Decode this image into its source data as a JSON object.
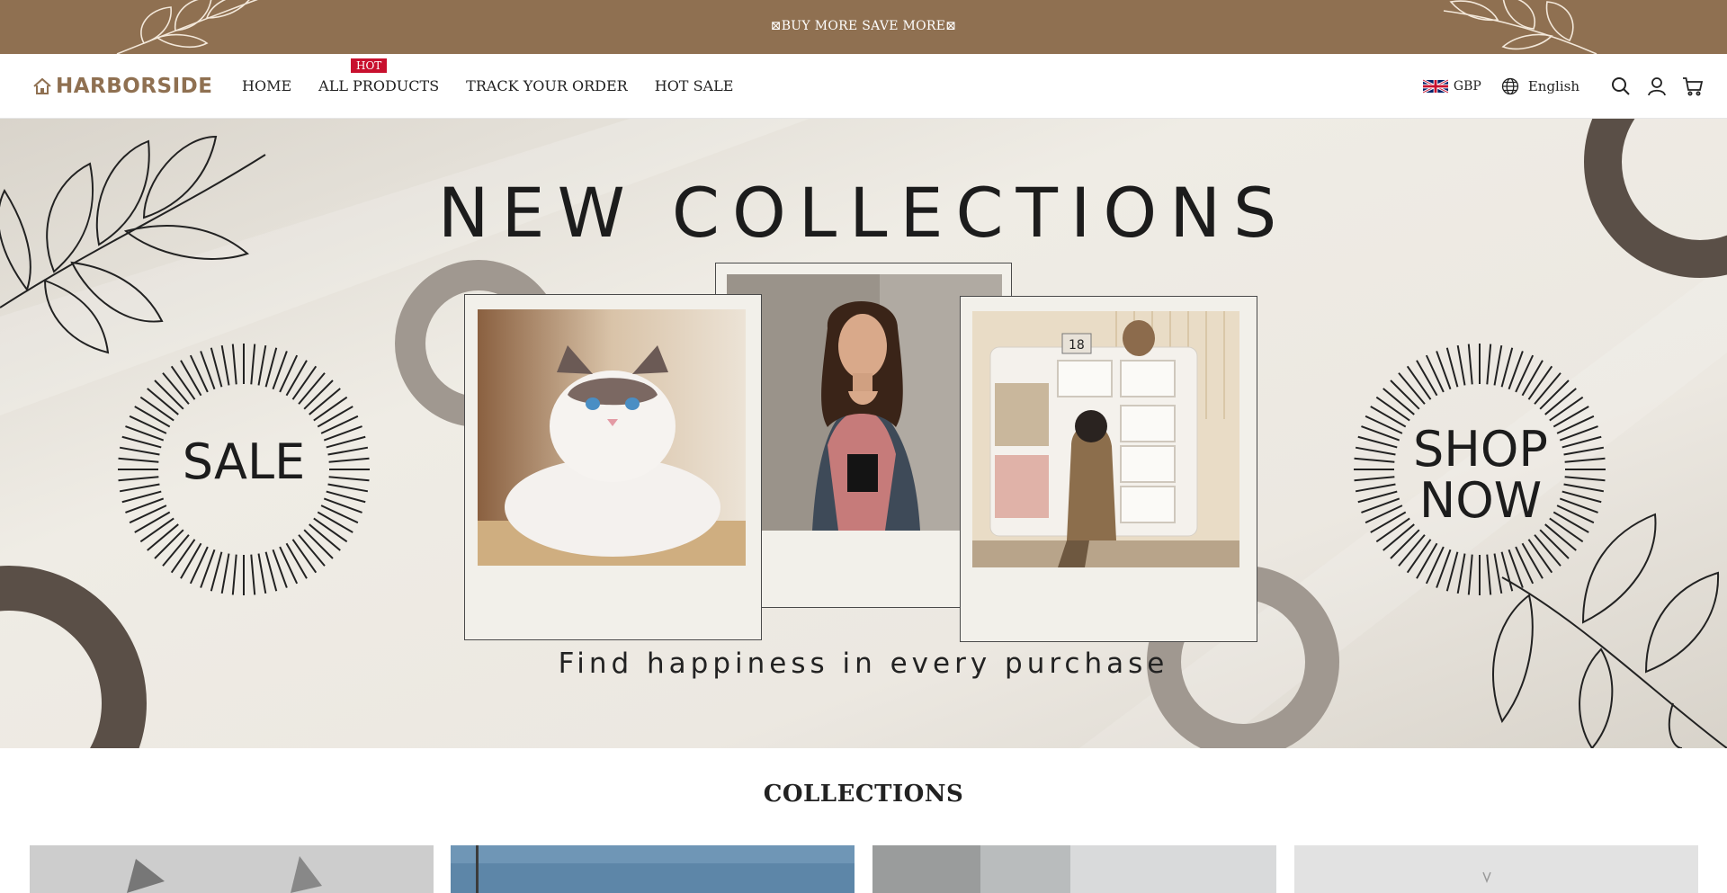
{
  "announcement": {
    "text": "⊠BUY MORE SAVE MORE⊠"
  },
  "header": {
    "brand": "HARBORSIDE",
    "nav": [
      {
        "label": "HOME"
      },
      {
        "label": "ALL PRODUCTS",
        "badge": "HOT"
      },
      {
        "label": "TRACK YOUR ORDER"
      },
      {
        "label": "HOT SALE"
      }
    ],
    "currency": "GBP",
    "language": "English",
    "icons": [
      "uk-flag-icon",
      "globe-icon",
      "search-icon",
      "user-icon",
      "cart-icon"
    ]
  },
  "hero": {
    "title": "NEW COLLECTIONS",
    "left_badge": "SALE",
    "right_badge_line1": "SHOP",
    "right_badge_line2": "NOW",
    "tagline": "Find happiness in every purchase",
    "calendar_digits": "18"
  },
  "collections": {
    "heading": "COLLECTIONS"
  },
  "colors": {
    "brand": "#8f7051",
    "badge_red": "#c8102e",
    "hero_bg": "#ebe7df",
    "ring_dark": "#5a4f47",
    "ring_light": "#a09890"
  }
}
